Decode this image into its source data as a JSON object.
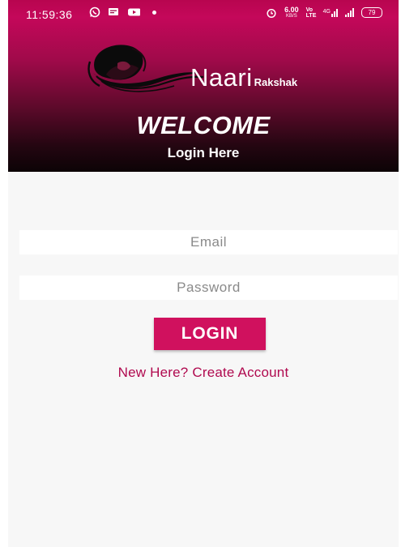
{
  "status_bar": {
    "time": "11:59:36",
    "left_icons": [
      "whatsapp-icon",
      "message-icon",
      "youtube-icon",
      "dot-icon"
    ],
    "network_speed": "6.00",
    "network_speed_unit": "KB/S",
    "volte": "Vo LTE",
    "signal_label": "4G",
    "battery": "79"
  },
  "header": {
    "brand_main": "Naari",
    "brand_sub": "Rakshak",
    "welcome": "WELCOME",
    "subtitle": "Login Here",
    "colors": {
      "top": "#c4085a",
      "bottom": "#0c0306"
    }
  },
  "form": {
    "email_placeholder": "Email",
    "password_placeholder": "Password",
    "login_label": "LOGIN",
    "create_account": "New Here? Create Account",
    "accent": "#d0115e"
  }
}
